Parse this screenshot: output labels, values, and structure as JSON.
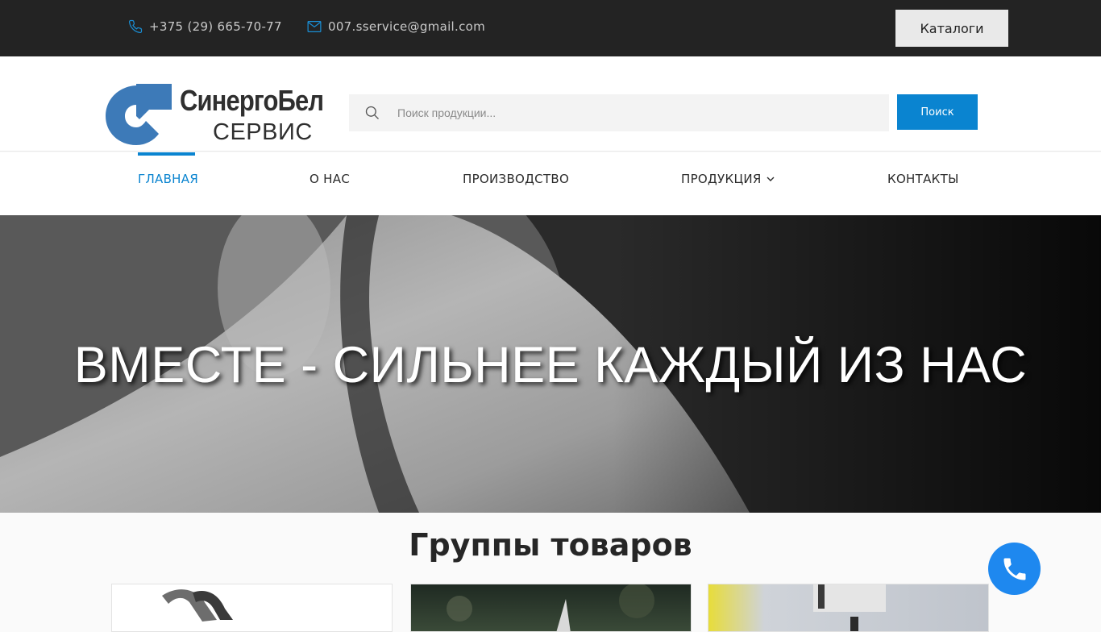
{
  "topbar": {
    "phone": "+375 (29) 665-70-77",
    "email": "007.sservice@gmail.com",
    "catalogs_label": "Каталоги"
  },
  "logo": {
    "name": "СинергоБел",
    "sub": "СЕРВИС"
  },
  "search": {
    "placeholder": "Поиск продукции...",
    "button_label": "Поиск"
  },
  "nav": {
    "items": [
      {
        "label": "Главная",
        "active": true
      },
      {
        "label": "О нас"
      },
      {
        "label": "Производство"
      },
      {
        "label": "Продукция",
        "has_dropdown": true
      },
      {
        "label": "Контакты"
      }
    ]
  },
  "hero": {
    "title": "ВМЕСТЕ - СИЛЬНЕЕ КАЖДЫЙ ИЗ НАС"
  },
  "groups": {
    "title": "Группы товаров"
  },
  "colors": {
    "accent": "#0a84d0",
    "topbar_bg": "#232323",
    "call_button": "#1e88ef"
  }
}
